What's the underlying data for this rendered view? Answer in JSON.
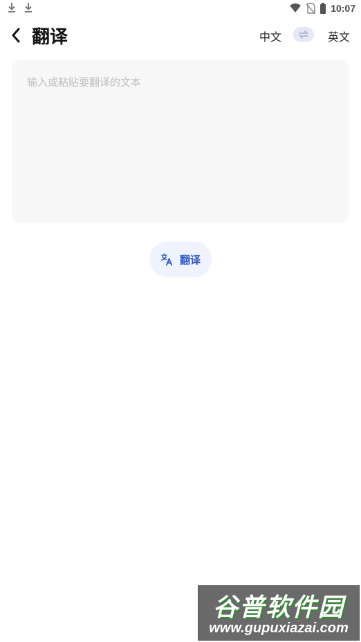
{
  "status_bar": {
    "time": "10:07",
    "left_icons": [
      "download-icon",
      "download-icon"
    ],
    "right_icons": [
      "wifi-icon",
      "no-sim-icon",
      "battery-icon"
    ]
  },
  "header": {
    "back_icon": "chevron-left-icon",
    "title": "翻译",
    "source_language": "中文",
    "swap_icon": "swap-arrows-icon",
    "target_language": "英文"
  },
  "input": {
    "placeholder": "输入或粘贴要翻译的文本",
    "value": ""
  },
  "translate_button": {
    "icon": "translate-icon",
    "label": "翻译"
  },
  "watermark": {
    "title": "谷普软件园",
    "url": "www.gupuxiazai.com"
  },
  "colors": {
    "accent": "#2f56c7",
    "button_bg": "#eef3fe",
    "card_bg": "#f7f7f7",
    "swap_bg": "#e4e9f5"
  }
}
